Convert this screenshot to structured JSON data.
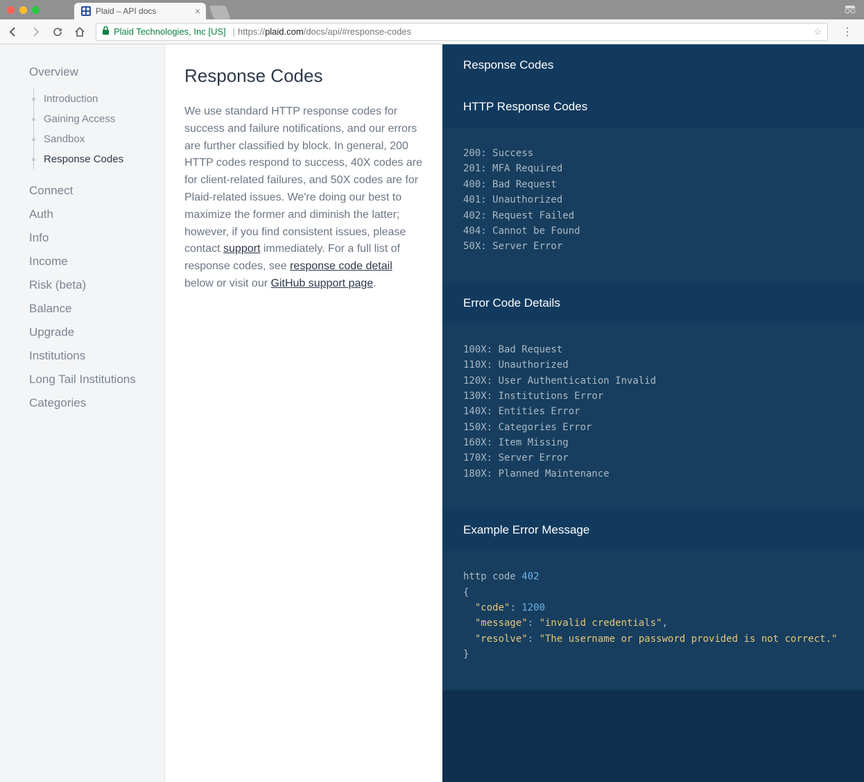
{
  "chrome": {
    "tab_title": "Plaid – API docs",
    "ev_label": "Plaid Technologies, Inc [US]",
    "url_proto": "https://",
    "url_domain": "plaid.com",
    "url_path": "/docs/api/#response-codes"
  },
  "sidebar": {
    "overview": "Overview",
    "subitems": [
      {
        "label": "Introduction",
        "active": false
      },
      {
        "label": "Gaining Access",
        "active": false
      },
      {
        "label": "Sandbox",
        "active": false
      },
      {
        "label": "Response Codes",
        "active": true
      }
    ],
    "items": [
      "Connect",
      "Auth",
      "Info",
      "Income",
      "Risk (beta)",
      "Balance",
      "Upgrade",
      "Institutions",
      "Long Tail Institutions",
      "Categories"
    ]
  },
  "main": {
    "heading": "Response Codes",
    "p1": "We use standard HTTP response codes for success and failure notifications, and our errors are further classified by block. In general, 200 HTTP codes respond to success, 40X codes are for client-related failures, and 50X codes are for Plaid-related issues. We're doing our best to maximize the former and diminish the latter; however, if you find consistent issues, please contact ",
    "link1": "support",
    "p2": " immediately. For a full list of response codes, see ",
    "link2": "response code detail",
    "p3": " below or visit our ",
    "link3": "GitHub support page",
    "p4": "."
  },
  "right": {
    "title1": "Response Codes",
    "title2": "HTTP Response Codes",
    "http_codes": [
      "200: Success",
      "201: MFA Required",
      "400: Bad Request",
      "401: Unauthorized",
      "402: Request Failed",
      "404: Cannot be Found",
      "50X: Server Error"
    ],
    "title3": "Error Code Details",
    "error_codes": [
      "100X: Bad Request",
      "110X: Unauthorized",
      "120X: User Authentication Invalid",
      "130X: Institutions Error",
      "140X: Entities Error",
      "150X: Categories Error",
      "160X: Item Missing",
      "170X: Server Error",
      "180X: Planned Maintenance"
    ],
    "title4": "Example Error Message",
    "example": {
      "pre": "http code ",
      "http_num": "402",
      "open": "{",
      "k1": "\"code\"",
      "v1": "1200",
      "k2": "\"message\"",
      "v2": "\"invalid credentials\"",
      "k3": "\"resolve\"",
      "v3": "\"The username or password provided is not correct.\"",
      "close": "}"
    }
  }
}
